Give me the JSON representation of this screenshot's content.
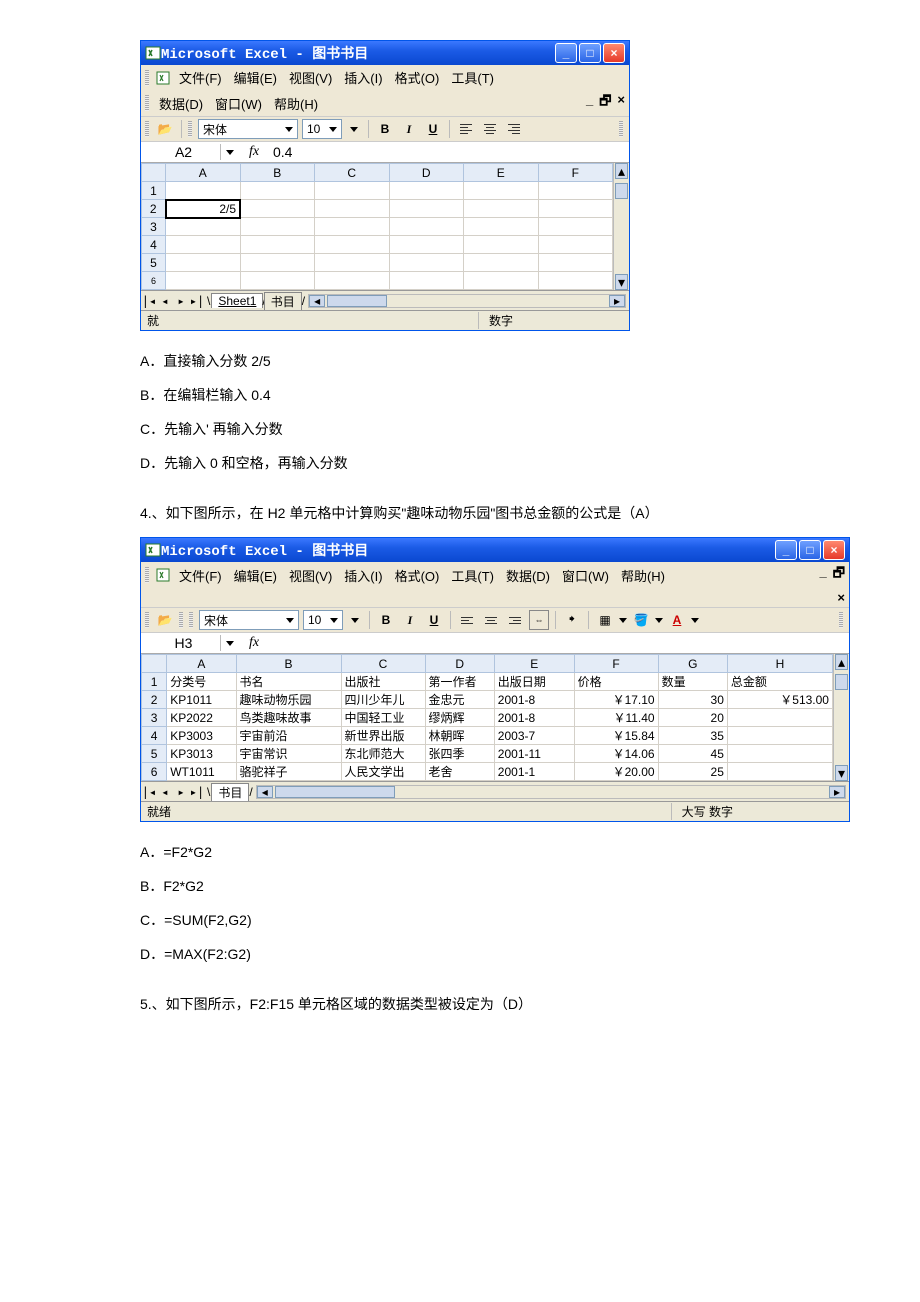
{
  "excel1": {
    "title": "Microsoft Excel - 图书书目",
    "menus_row1": [
      "文件(F)",
      "编辑(E)",
      "视图(V)",
      "插入(I)",
      "格式(O)",
      "工具(T)"
    ],
    "menus_row2": [
      "数据(D)",
      "窗口(W)",
      "帮助(H)"
    ],
    "font_name": "宋体",
    "font_size": "10",
    "name_box": "A2",
    "fx_label": "fx",
    "fx_value": "0.4",
    "col_headers": [
      "A",
      "B",
      "C",
      "D",
      "E",
      "F"
    ],
    "row_headers": [
      "1",
      "2",
      "3",
      "4",
      "5",
      "6"
    ],
    "cell_a2": "2/5",
    "sheet_tabs": [
      "Sheet1",
      "书目"
    ],
    "status_right": "数字",
    "status_left": "就"
  },
  "q3_options": {
    "a": "A．直接输入分数 2/5",
    "b": "B．在编辑栏输入 0.4",
    "c": "C．先输入'   再输入分数",
    "d": "D．先输入 0 和空格，再输入分数"
  },
  "q4_text": "4.、如下图所示，在 H2 单元格中计算购买\"趣味动物乐园\"图书总金额的公式是（A）",
  "excel2": {
    "title": "Microsoft Excel - 图书书目",
    "menus": [
      "文件(F)",
      "编辑(E)",
      "视图(V)",
      "插入(I)",
      "格式(O)",
      "工具(T)",
      "数据(D)",
      "窗口(W)",
      "帮助(H)"
    ],
    "font_name": "宋体",
    "font_size": "10",
    "name_box": "H3",
    "fx_label": "fx",
    "col_headers": [
      "A",
      "B",
      "C",
      "D",
      "E",
      "F",
      "G",
      "H"
    ],
    "rows": [
      {
        "n": "1",
        "a": "分类号",
        "b": "书名",
        "c": "出版社",
        "d": "第一作者",
        "e": "出版日期",
        "f": "价格",
        "g": "数量",
        "h": "总金额"
      },
      {
        "n": "2",
        "a": "KP1011",
        "b": "趣味动物乐园",
        "c": "四川少年儿",
        "d": "金忠元",
        "e": "2001-8",
        "f": "￥17.10",
        "g": "30",
        "h": "￥513.00"
      },
      {
        "n": "3",
        "a": "KP2022",
        "b": "鸟类趣味故事",
        "c": "中国轻工业",
        "d": "缪炳辉",
        "e": "2001-8",
        "f": "￥11.40",
        "g": "20",
        "h": ""
      },
      {
        "n": "4",
        "a": "KP3003",
        "b": "宇宙前沿",
        "c": "新世界出版",
        "d": "林朝晖",
        "e": "2003-7",
        "f": "￥15.84",
        "g": "35",
        "h": ""
      },
      {
        "n": "5",
        "a": "KP3013",
        "b": "宇宙常识",
        "c": "东北师范大",
        "d": "张四季",
        "e": "2001-11",
        "f": "￥14.06",
        "g": "45",
        "h": ""
      },
      {
        "n": "6",
        "a": "WT1011",
        "b": "骆驼祥子",
        "c": "人民文学出",
        "d": "老舍",
        "e": "2001-1",
        "f": "￥20.00",
        "g": "25",
        "h": ""
      }
    ],
    "sheet_tabs": [
      "书目"
    ],
    "status_left": "就绪",
    "status_right": "大写 数字"
  },
  "q4_options": {
    "a": "A．=F2*G2",
    "b": "B．F2*G2",
    "c": "C．=SUM(F2,G2)",
    "d": "D．=MAX(F2:G2)"
  },
  "q5_text": "5.、如下图所示，F2:F15 单元格区域的数据类型被设定为（D）"
}
